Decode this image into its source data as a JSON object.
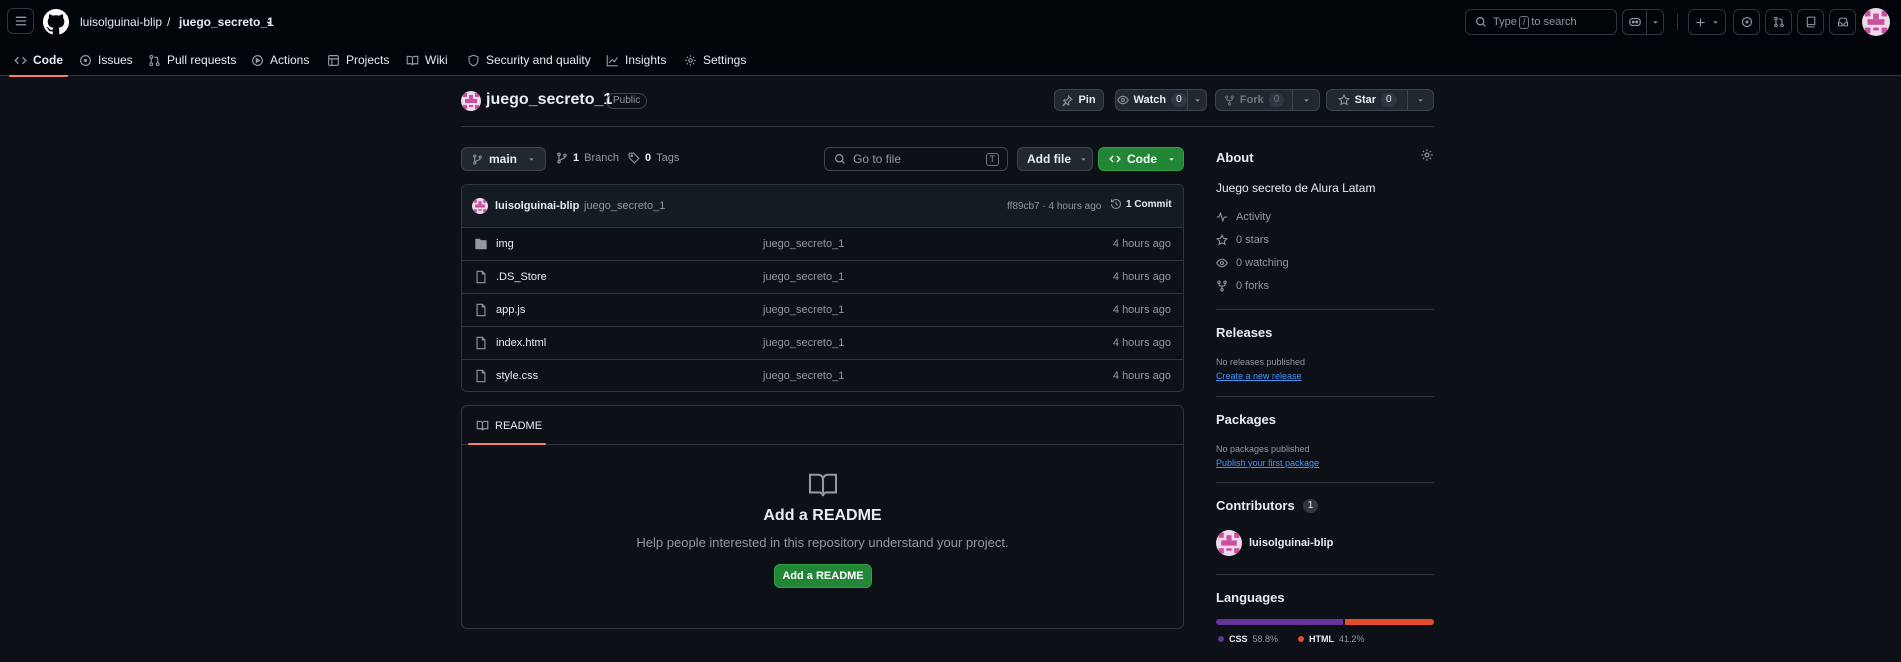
{
  "header": {
    "owner": "luisolguinai-blip",
    "separator": "/",
    "repo": "juego_secreto_1",
    "search": {
      "prefix": "Type",
      "key": "/",
      "suffix": "to search"
    }
  },
  "tabs": [
    {
      "label": "Code"
    },
    {
      "label": "Issues"
    },
    {
      "label": "Pull requests"
    },
    {
      "label": "Actions"
    },
    {
      "label": "Projects"
    },
    {
      "label": "Wiki"
    },
    {
      "label": "Security and quality"
    },
    {
      "label": "Insights"
    },
    {
      "label": "Settings"
    }
  ],
  "repo": {
    "name": "juego_secreto_1",
    "visibility": "Public",
    "pin_label": "Pin",
    "watch_label": "Watch",
    "watch_count": "0",
    "fork_label": "Fork",
    "fork_count": "0",
    "star_label": "Star",
    "star_count": "0"
  },
  "filenav": {
    "branch": "main",
    "branch_count": "1",
    "branch_label": "Branch",
    "tag_count": "0",
    "tag_label": "Tags",
    "goto_placeholder": "Go to file",
    "goto_key": "T",
    "add_file": "Add file",
    "code": "Code"
  },
  "commit": {
    "author": "luisolguinai-blip",
    "message": "juego_secreto_1",
    "hash_time": "ff89cb7 · 4 hours ago",
    "count": "1 Commit"
  },
  "files": [
    {
      "name": "img",
      "type": "folder",
      "message": "juego_secreto_1",
      "time": "4 hours ago"
    },
    {
      "name": ".DS_Store",
      "type": "file",
      "message": "juego_secreto_1",
      "time": "4 hours ago"
    },
    {
      "name": "app.js",
      "type": "file",
      "message": "juego_secreto_1",
      "time": "4 hours ago"
    },
    {
      "name": "index.html",
      "type": "file",
      "message": "juego_secreto_1",
      "time": "4 hours ago"
    },
    {
      "name": "style.css",
      "type": "file",
      "message": "juego_secreto_1",
      "time": "4 hours ago"
    }
  ],
  "readme": {
    "tab": "README",
    "title": "Add a README",
    "description": "Help people interested in this repository understand your project.",
    "button": "Add a README"
  },
  "sidebar": {
    "about_title": "About",
    "description": "Juego secreto de Alura Latam",
    "activity": "Activity",
    "stars": "0 stars",
    "watching": "0 watching",
    "forks": "0 forks",
    "releases_title": "Releases",
    "releases_none": "No releases published",
    "releases_link": "Create a new release",
    "packages_title": "Packages",
    "packages_none": "No packages published",
    "packages_link": "Publish your first package",
    "contributors_title": "Contributors",
    "contributors_count": "1",
    "contributor": "luisolguinai-blip",
    "languages_title": "Languages",
    "languages": [
      {
        "name": "CSS",
        "percent": "58.8%",
        "value": 58.8,
        "color": "#663399"
      },
      {
        "name": "HTML",
        "percent": "41.2%",
        "value": 41.2,
        "color": "#e34c26"
      }
    ]
  },
  "colors": {
    "accent": "#238636",
    "link": "#4493f8",
    "tab_underline": "#f78166"
  }
}
